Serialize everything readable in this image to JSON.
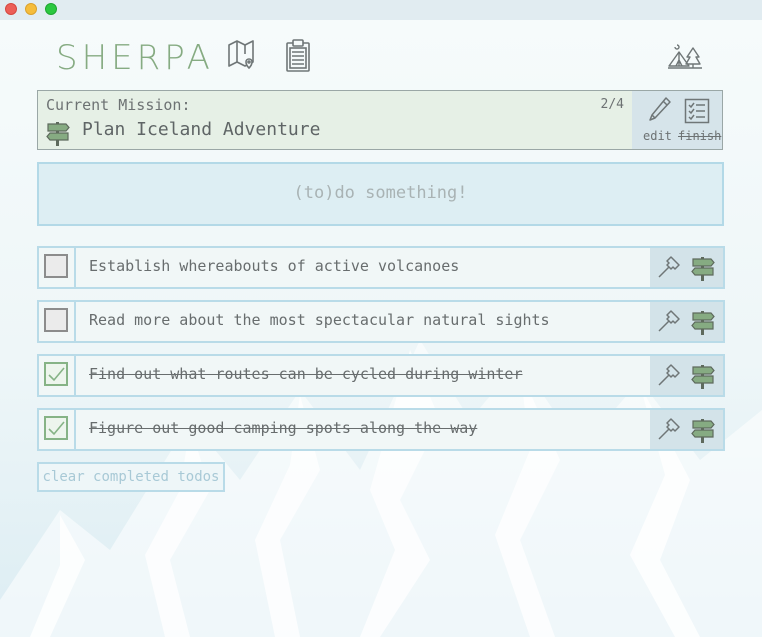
{
  "window": {
    "controls": [
      "close",
      "minimize",
      "zoom"
    ]
  },
  "header": {
    "logo": "SHERPA",
    "icons": [
      "map-pin-icon",
      "clipboard-icon",
      "camp-icon"
    ]
  },
  "mission": {
    "label": "Current Mission:",
    "title": "Plan Iceland Adventure",
    "progress": "2/4",
    "edit_label": "edit",
    "finish_label": "finish"
  },
  "new_todo": {
    "placeholder": "(to)do something!"
  },
  "todos": [
    {
      "text": "Establish whereabouts of active volcanoes",
      "done": false
    },
    {
      "text": "Read more about the most spectacular natural sights",
      "done": false
    },
    {
      "text": "Find out what routes can be cycled during winter",
      "done": true
    },
    {
      "text": "Figure out good camping spots along the way",
      "done": true
    }
  ],
  "clear_label": "clear completed todos",
  "colors": {
    "accent_green": "#86ab82",
    "light_blue": "#b9dbe8",
    "text_gray": "#686d6e"
  }
}
